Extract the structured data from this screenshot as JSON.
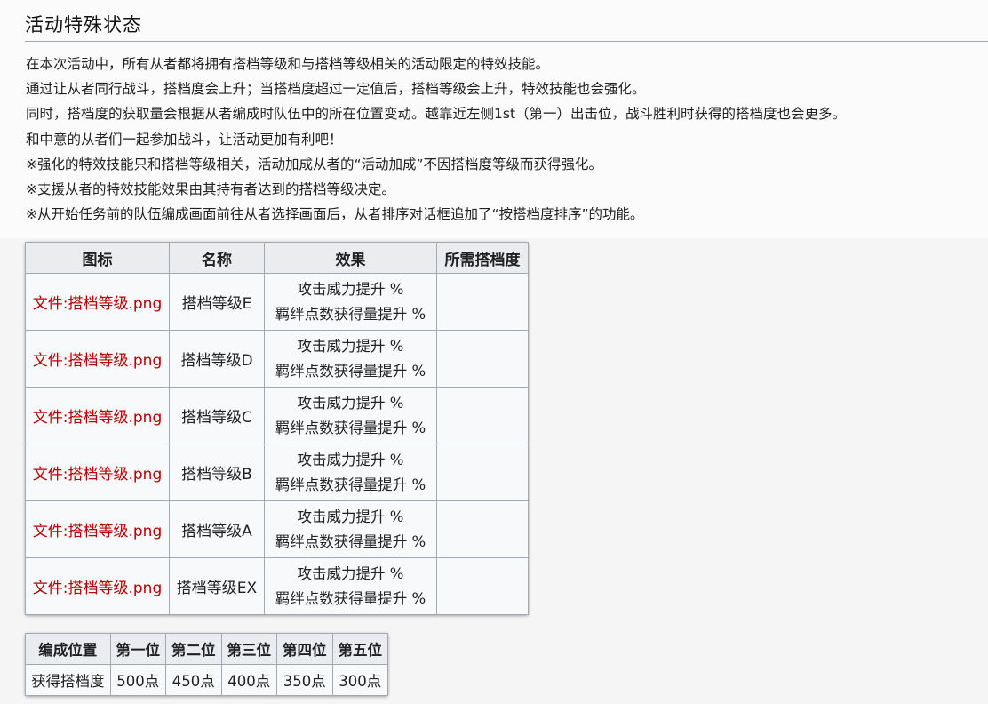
{
  "section": {
    "title": "活动特殊状态",
    "paragraphs": [
      "在本次活动中，所有从者都将拥有搭档等级和与搭档等级相关的活动限定的特效技能。",
      "通过让从者同行战斗，搭档度会上升；当搭档度超过一定值后，搭档等级会上升，特效技能也会强化。",
      "同时，搭档度的获取量会根据从者编成时队伍中的所在位置变动。越靠近左侧1st（第一）出击位，战斗胜利时获得的搭档度也会更多。",
      "和中意的从者们一起参加战斗，让活动更加有利吧！",
      "※强化的特效技能只和搭档等级相关，活动加成从者的“活动加成”不因搭档度等级而获得强化。",
      "※支援从者的特效技能效果由其持有者达到的搭档等级决定。",
      "※从开始任务前的队伍编成画面前往从者选择画面后，从者排序对话框追加了“按搭档度排序”的功能。"
    ]
  },
  "level_table": {
    "headers": [
      "图标",
      "名称",
      "效果",
      "所需搭档度"
    ],
    "rows": [
      {
        "icon": "文件:搭档等级.png",
        "name": "搭档等级E",
        "effect1": "攻击威力提升 %",
        "effect2": "羁绊点数获得量提升 %",
        "required": ""
      },
      {
        "icon": "文件:搭档等级.png",
        "name": "搭档等级D",
        "effect1": "攻击威力提升 %",
        "effect2": "羁绊点数获得量提升 %",
        "required": ""
      },
      {
        "icon": "文件:搭档等级.png",
        "name": "搭档等级C",
        "effect1": "攻击威力提升 %",
        "effect2": "羁绊点数获得量提升 %",
        "required": ""
      },
      {
        "icon": "文件:搭档等级.png",
        "name": "搭档等级B",
        "effect1": "攻击威力提升 %",
        "effect2": "羁绊点数获得量提升 %",
        "required": ""
      },
      {
        "icon": "文件:搭档等级.png",
        "name": "搭档等级A",
        "effect1": "攻击威力提升 %",
        "effect2": "羁绊点数获得量提升 %",
        "required": ""
      },
      {
        "icon": "文件:搭档等级.png",
        "name": "搭档等级EX",
        "effect1": "攻击威力提升 %",
        "effect2": "羁绊点数获得量提升 %",
        "required": ""
      }
    ]
  },
  "position_table": {
    "headers": [
      "编成位置",
      "第一位",
      "第二位",
      "第三位",
      "第四位",
      "第五位"
    ],
    "row_label": "获得搭档度",
    "values": [
      "500点",
      "450点",
      "400点",
      "350点",
      "300点"
    ]
  },
  "colors": {
    "missing_link": "#ba0000",
    "header_bg": "#eaecf0",
    "border": "#a2a9b1"
  }
}
